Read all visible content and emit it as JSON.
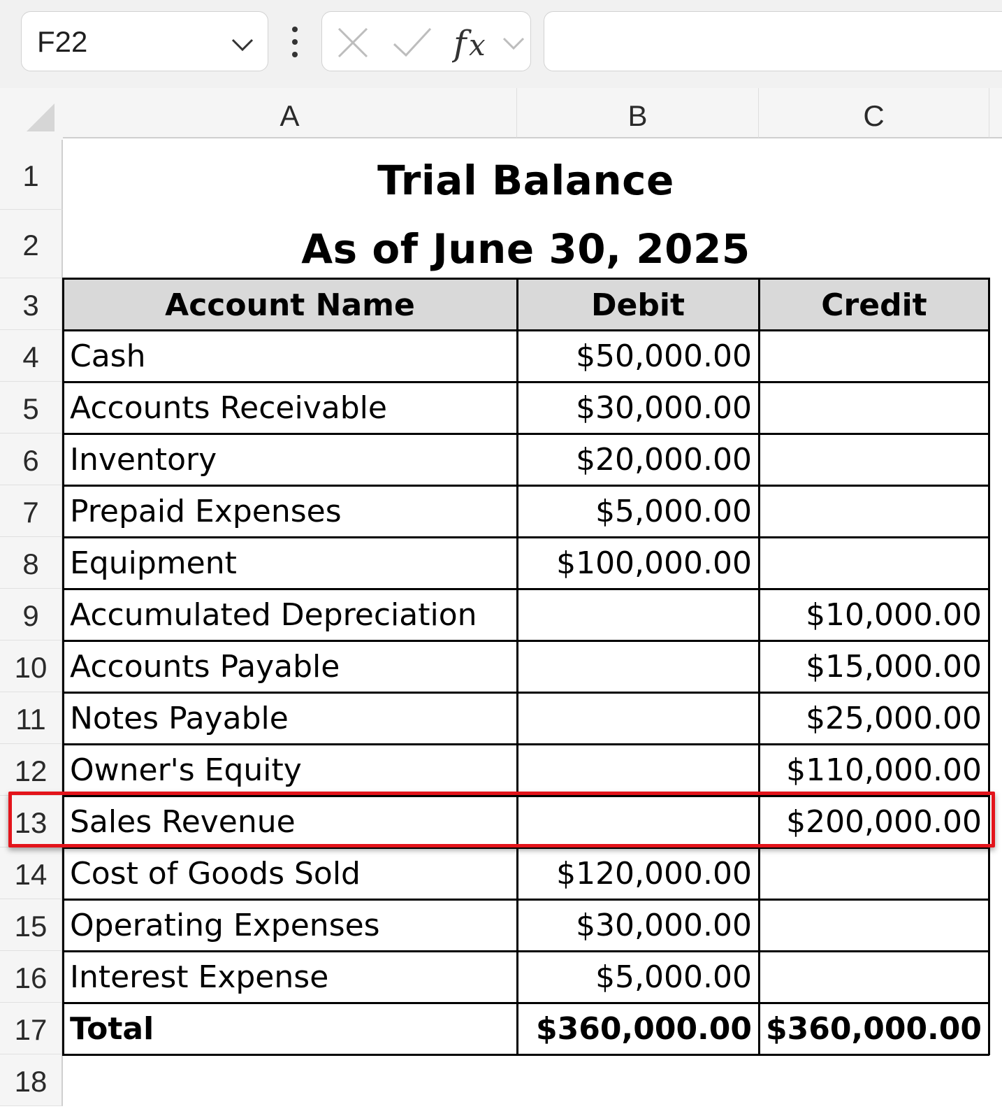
{
  "formula_bar": {
    "name_box": "F22",
    "formula": ""
  },
  "icons": {
    "name_box_dropdown": "chevron-down-icon",
    "more": "vertical-ellipsis-icon",
    "cancel": "x-icon",
    "enter": "check-icon",
    "function": "fx-icon"
  },
  "columns": [
    "A",
    "B",
    "C"
  ],
  "rows": [
    "1",
    "2",
    "3",
    "4",
    "5",
    "6",
    "7",
    "8",
    "9",
    "10",
    "11",
    "12",
    "13",
    "14",
    "15",
    "16",
    "17",
    "18"
  ],
  "sheet": {
    "title": "Trial Balance",
    "subtitle": "As of June 30, 2025",
    "headers": {
      "account": "Account Name",
      "debit": "Debit",
      "credit": "Credit"
    },
    "entries": [
      {
        "account": "Cash",
        "debit": "$50,000.00",
        "credit": ""
      },
      {
        "account": "Accounts Receivable",
        "debit": "$30,000.00",
        "credit": ""
      },
      {
        "account": "Inventory",
        "debit": "$20,000.00",
        "credit": ""
      },
      {
        "account": "Prepaid Expenses",
        "debit": "$5,000.00",
        "credit": ""
      },
      {
        "account": "Equipment",
        "debit": "$100,000.00",
        "credit": ""
      },
      {
        "account": "Accumulated Depreciation",
        "debit": "",
        "credit": "$10,000.00"
      },
      {
        "account": "Accounts Payable",
        "debit": "",
        "credit": "$15,000.00"
      },
      {
        "account": "Notes Payable",
        "debit": "",
        "credit": "$25,000.00"
      },
      {
        "account": "Owner's Equity",
        "debit": "",
        "credit": "$110,000.00"
      },
      {
        "account": "Sales Revenue",
        "debit": "",
        "credit": "$200,000.00"
      },
      {
        "account": "Cost of Goods Sold",
        "debit": "$120,000.00",
        "credit": ""
      },
      {
        "account": "Operating Expenses",
        "debit": "$30,000.00",
        "credit": ""
      },
      {
        "account": "Interest Expense",
        "debit": "$5,000.00",
        "credit": ""
      }
    ],
    "total": {
      "account": "Total",
      "debit": "$360,000.00",
      "credit": "$360,000.00"
    }
  },
  "highlight": {
    "row": "13",
    "color": "#e3141b"
  },
  "colors": {
    "header_fill": "#d9d9d9",
    "chrome": "#f1f1f1"
  }
}
